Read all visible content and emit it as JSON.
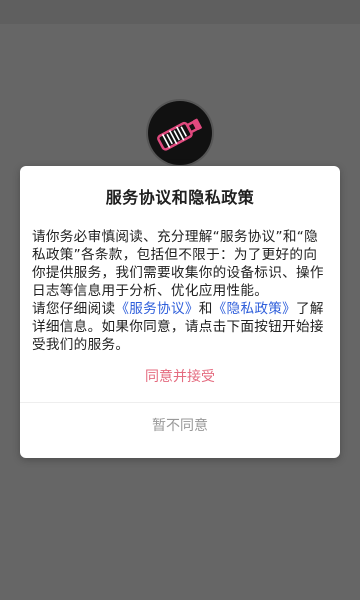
{
  "colors": {
    "overlay_background": "#666666",
    "dialog_background": "#ffffff",
    "title_text": "#1f1f1f",
    "body_text": "#222222",
    "link": "#2f5fdb",
    "agree_button": "#e46b7f",
    "disagree_button": "#999999",
    "logo_accent": "#e0497e"
  },
  "splash": {
    "logo_icon": "bottle-logo-icon"
  },
  "dialog": {
    "title": "服务协议和隐私政策",
    "paragraph1": "请你务必审慎阅读、充分理解“服务协议”和“隐私政策”各条款，包括但不限于：为了更好的向你提供服务，我们需要收集你的设备标识、操作日志等信息用于分析、优化应用性能。",
    "paragraph2": {
      "prefix": "请您仔细阅读",
      "service_link": "《服务协议》",
      "and": "和",
      "privacy_link": "《隐私政策》",
      "suffix": "了解详细信息。如果你同意，请点击下面按钮开始接受我们的服务。"
    },
    "agree_label": "同意并接受",
    "disagree_label": "暂不同意"
  }
}
